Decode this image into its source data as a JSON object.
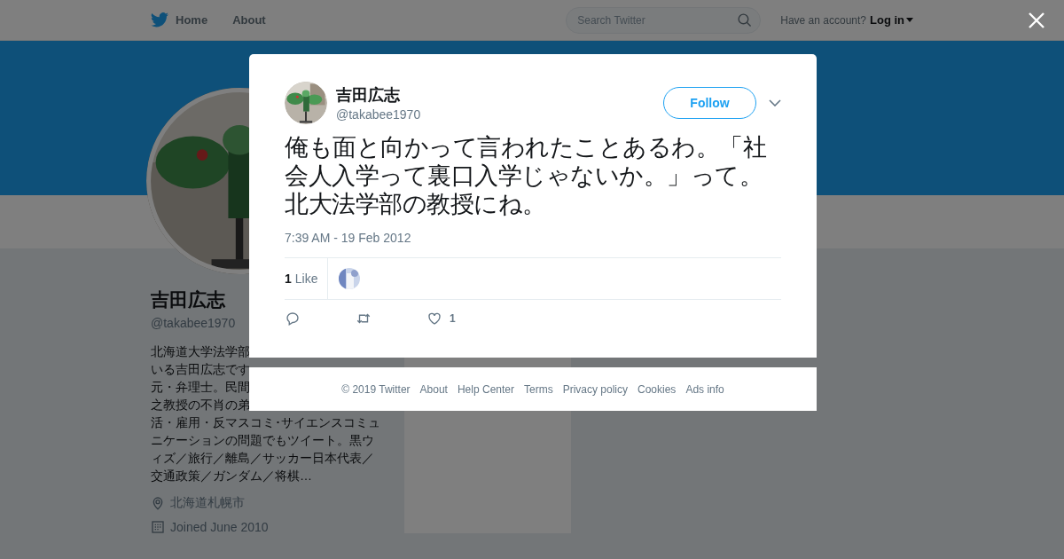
{
  "nav": {
    "items": [
      {
        "label": "Home",
        "kind": "home"
      },
      {
        "label": "About",
        "kind": "plain"
      }
    ],
    "search": {
      "placeholder": "Search Twitter"
    },
    "account_prompt": "Have an account?",
    "login": "Log in"
  },
  "profile": {
    "name": "吉田広志",
    "handle": "@takabee1970",
    "bio_lines": [
      "北海道大学法学部",
      "いる吉田広志です",
      "元・弁理士。民間",
      "之教授の不肖の弟",
      "活・雇用・反マスコミ･サイエンスコミュ",
      "ニケーションの問題でもツイート。黒ウ",
      "ィズ／旅行／離島／サッカー日本代表／",
      "交通政策／ガンダム／将棋…"
    ],
    "location": "北海道札幌市",
    "joined": "Joined June 2010"
  },
  "tweet": {
    "name": "吉田広志",
    "handle": "@takabee1970",
    "follow": "Follow",
    "text": "俺も面と向かって言われたことあるわ。「社会人入学って裏口入学じゃないか。」って。北大法学部の教授にね。",
    "timestamp": "7:39 AM - 19 Feb 2012",
    "likes_count": "1",
    "likes_label": "Like",
    "actions": [
      {
        "kind": "reply"
      },
      {
        "kind": "retweet"
      },
      {
        "kind": "like",
        "count": "1"
      }
    ]
  },
  "footer": {
    "links": [
      "© 2019 Twitter",
      "About",
      "Help Center",
      "Terms",
      "Privacy policy",
      "Cookies",
      "Ads info"
    ]
  }
}
